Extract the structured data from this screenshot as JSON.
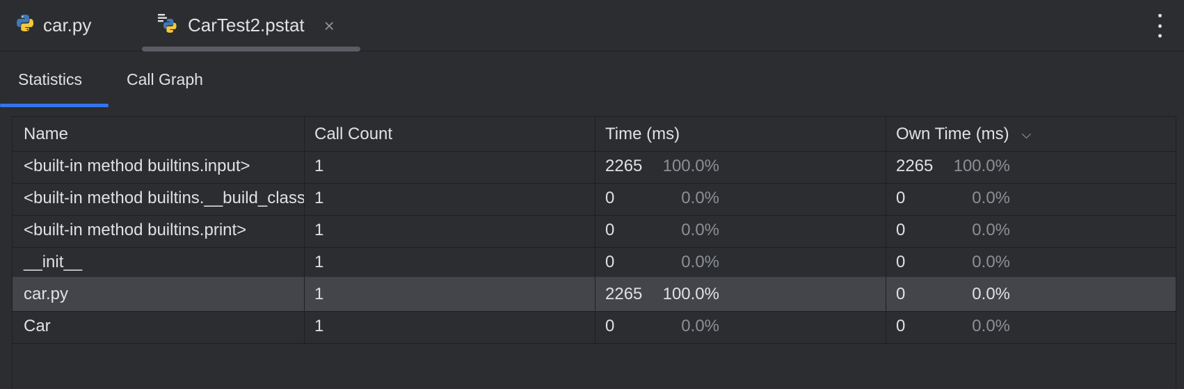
{
  "tabs": [
    {
      "label": "car.py",
      "icon": "python-icon"
    },
    {
      "label": "CarTest2.pstat",
      "icon": "profiler-python-icon",
      "closable": true
    }
  ],
  "close_glyph": "×",
  "subtabs": [
    {
      "label": "Statistics",
      "active": true
    },
    {
      "label": "Call Graph",
      "active": false
    }
  ],
  "table": {
    "columns": [
      "Name",
      "Call Count",
      "Time (ms)",
      "Own Time (ms)"
    ],
    "sort_column": "Own Time (ms)",
    "sort_glyph": "⌵",
    "rows": [
      {
        "name": "<built-in method builtins.input>",
        "calls": "1",
        "time": "2265",
        "time_pct": "100.0%",
        "own": "2265",
        "own_pct": "100.0%"
      },
      {
        "name": "<built-in method builtins.__build_class__>",
        "calls": "1",
        "time": "0",
        "time_pct": "0.0%",
        "own": "0",
        "own_pct": "0.0%"
      },
      {
        "name": "<built-in method builtins.print>",
        "calls": "1",
        "time": "0",
        "time_pct": "0.0%",
        "own": "0",
        "own_pct": "0.0%"
      },
      {
        "name": "__init__",
        "calls": "1",
        "time": "0",
        "time_pct": "0.0%",
        "own": "0",
        "own_pct": "0.0%"
      },
      {
        "name": "car.py",
        "calls": "1",
        "time": "2265",
        "time_pct": "100.0%",
        "own": "0",
        "own_pct": "0.0%",
        "selected": true
      },
      {
        "name": "Car",
        "calls": "1",
        "time": "0",
        "time_pct": "0.0%",
        "own": "0",
        "own_pct": "0.0%"
      }
    ]
  },
  "colors": {
    "background": "#2b2d30",
    "accent": "#3574f0",
    "selected_row": "#43454a",
    "python_blue": "#3d7ab8",
    "python_yellow": "#f5c73b"
  }
}
